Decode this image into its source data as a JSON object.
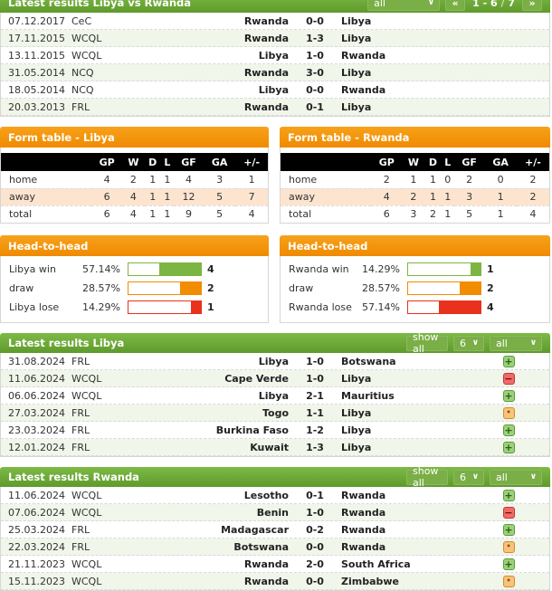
{
  "h2h_results": {
    "title": "Latest results Libya vs Rwanda",
    "filter": "all",
    "pager_prev": "«",
    "pager_next": "»",
    "pager_range": "1 - 6",
    "pager_total": "7",
    "matches": [
      {
        "date": "07.12.2017",
        "comp": "CeC",
        "home": "Rwanda",
        "score": "0-0",
        "away": "Libya"
      },
      {
        "date": "17.11.2015",
        "comp": "WCQL",
        "home": "Rwanda",
        "score": "1-3",
        "away": "Libya"
      },
      {
        "date": "13.11.2015",
        "comp": "WCQL",
        "home": "Libya",
        "score": "1-0",
        "away": "Rwanda"
      },
      {
        "date": "31.05.2014",
        "comp": "NCQ",
        "home": "Rwanda",
        "score": "3-0",
        "away": "Libya"
      },
      {
        "date": "18.05.2014",
        "comp": "NCQ",
        "home": "Libya",
        "score": "0-0",
        "away": "Rwanda"
      },
      {
        "date": "20.03.2013",
        "comp": "FRL",
        "home": "Rwanda",
        "score": "0-1",
        "away": "Libya"
      }
    ]
  },
  "form_tables": [
    {
      "title": "Form table - Libya",
      "headers": [
        "",
        "GP",
        "W",
        "D",
        "L",
        "GF",
        "GA",
        "+/-"
      ],
      "rows": [
        {
          "label": "home",
          "values": [
            "4",
            "2",
            "1",
            "1",
            "4",
            "3",
            "1"
          ]
        },
        {
          "label": "away",
          "values": [
            "6",
            "4",
            "1",
            "1",
            "12",
            "5",
            "7"
          ]
        },
        {
          "label": "total",
          "values": [
            "6",
            "4",
            "1",
            "1",
            "9",
            "5",
            "4"
          ]
        }
      ]
    },
    {
      "title": "Form table - Rwanda",
      "headers": [
        "",
        "GP",
        "W",
        "D",
        "L",
        "GF",
        "GA",
        "+/-"
      ],
      "rows": [
        {
          "label": "home",
          "values": [
            "2",
            "1",
            "1",
            "0",
            "2",
            "0",
            "2"
          ]
        },
        {
          "label": "away",
          "values": [
            "4",
            "2",
            "1",
            "1",
            "3",
            "1",
            "2"
          ]
        },
        {
          "label": "total",
          "values": [
            "6",
            "3",
            "2",
            "1",
            "5",
            "1",
            "4"
          ]
        }
      ]
    }
  ],
  "head_to_head": [
    {
      "title": "Head-to-head",
      "rows": [
        {
          "label": "Libya win",
          "pct": "57.14%",
          "fraction": 0.5714,
          "count": "4",
          "color": "#7db544"
        },
        {
          "label": "draw",
          "pct": "28.57%",
          "fraction": 0.2857,
          "count": "2",
          "color": "#f28c00"
        },
        {
          "label": "Libya lose",
          "pct": "14.29%",
          "fraction": 0.1429,
          "count": "1",
          "color": "#e8321e"
        }
      ]
    },
    {
      "title": "Head-to-head",
      "rows": [
        {
          "label": "Rwanda win",
          "pct": "14.29%",
          "fraction": 0.1429,
          "count": "1",
          "color": "#7db544"
        },
        {
          "label": "draw",
          "pct": "28.57%",
          "fraction": 0.2857,
          "count": "2",
          "color": "#f28c00"
        },
        {
          "label": "Rwanda lose",
          "pct": "57.14%",
          "fraction": 0.5714,
          "count": "4",
          "color": "#e8321e"
        }
      ]
    }
  ],
  "latest_libya": {
    "title": "Latest results Libya",
    "show_all": "show all",
    "count_select": "6",
    "filter": "all",
    "matches": [
      {
        "date": "31.08.2024",
        "comp": "FRL",
        "home": "Libya",
        "score": "1-0",
        "away": "Botswana",
        "result": "win"
      },
      {
        "date": "11.06.2024",
        "comp": "WCQL",
        "home": "Cape Verde",
        "score": "1-0",
        "away": "Libya",
        "result": "lose"
      },
      {
        "date": "06.06.2024",
        "comp": "WCQL",
        "home": "Libya",
        "score": "2-1",
        "away": "Mauritius",
        "result": "win"
      },
      {
        "date": "27.03.2024",
        "comp": "FRL",
        "home": "Togo",
        "score": "1-1",
        "away": "Libya",
        "result": "draw"
      },
      {
        "date": "23.03.2024",
        "comp": "FRL",
        "home": "Burkina Faso",
        "score": "1-2",
        "away": "Libya",
        "result": "win"
      },
      {
        "date": "12.01.2024",
        "comp": "FRL",
        "home": "Kuwait",
        "score": "1-3",
        "away": "Libya",
        "result": "win"
      }
    ]
  },
  "latest_rwanda": {
    "title": "Latest results Rwanda",
    "show_all": "show all",
    "count_select": "6",
    "filter": "all",
    "matches": [
      {
        "date": "11.06.2024",
        "comp": "WCQL",
        "home": "Lesotho",
        "score": "0-1",
        "away": "Rwanda",
        "result": "win"
      },
      {
        "date": "07.06.2024",
        "comp": "WCQL",
        "home": "Benin",
        "score": "1-0",
        "away": "Rwanda",
        "result": "lose"
      },
      {
        "date": "25.03.2024",
        "comp": "FRL",
        "home": "Madagascar",
        "score": "0-2",
        "away": "Rwanda",
        "result": "win"
      },
      {
        "date": "22.03.2024",
        "comp": "FRL",
        "home": "Botswana",
        "score": "0-0",
        "away": "Rwanda",
        "result": "draw"
      },
      {
        "date": "21.11.2023",
        "comp": "WCQL",
        "home": "Rwanda",
        "score": "2-0",
        "away": "South Africa",
        "result": "win"
      },
      {
        "date": "15.11.2023",
        "comp": "WCQL",
        "home": "Rwanda",
        "score": "0-0",
        "away": "Zimbabwe",
        "result": "draw"
      }
    ]
  },
  "icons": {
    "win": "+",
    "lose": "−",
    "draw": "•",
    "chevron": "⌄"
  }
}
